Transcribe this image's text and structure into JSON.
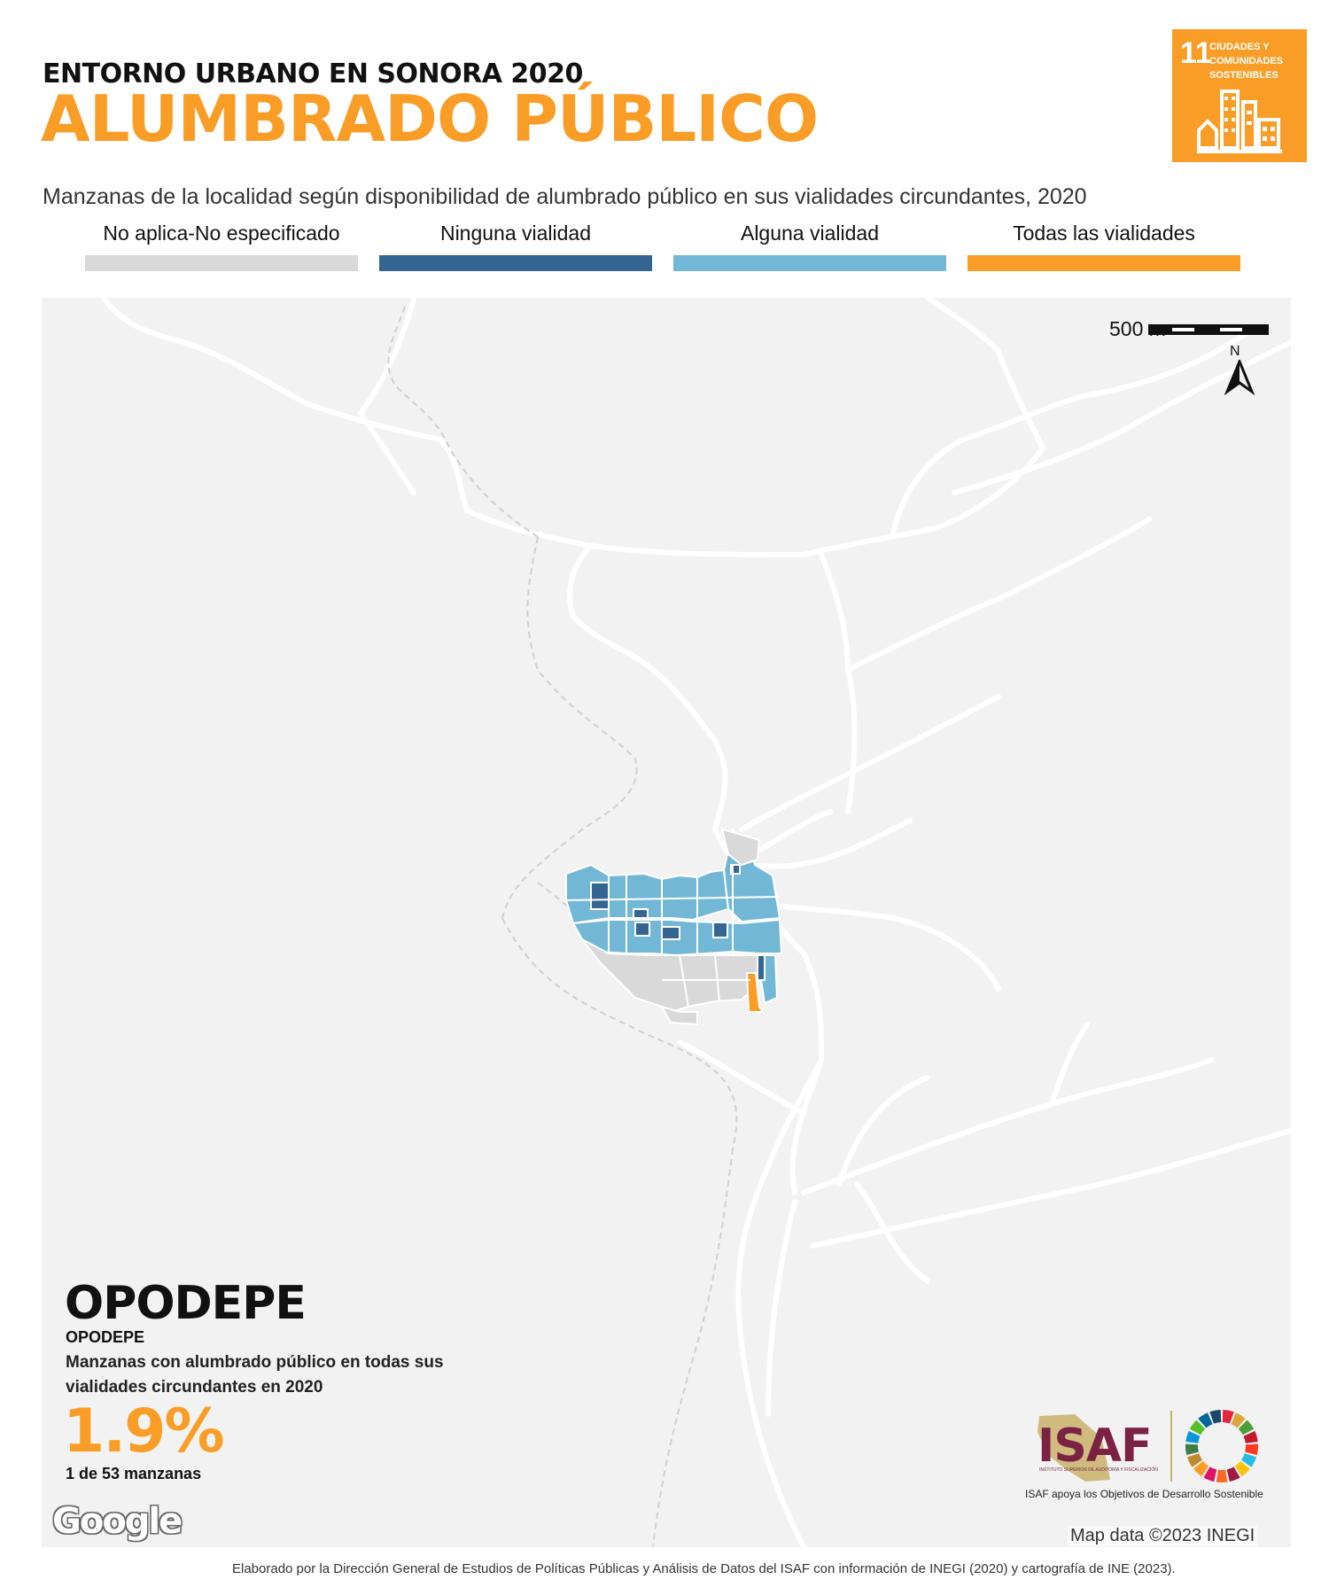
{
  "header": {
    "kicker": "ENTORNO URBANO EN SONORA 2020",
    "title": "ALUMBRADO PÚBLICO",
    "subtitle": "Manzanas de la localidad según disponibilidad de alumbrado público en sus vialidades circundantes, 2020"
  },
  "sdg_badge": {
    "number": "11",
    "text": "CIUDADES Y COMUNIDADES SOSTENIBLES",
    "color": "#f99d26",
    "icon": "city-buildings-icon"
  },
  "legend": [
    {
      "label": "No aplica-No especificado",
      "color": "#d9d9d9"
    },
    {
      "label": "Ninguna vialidad",
      "color": "#356592"
    },
    {
      "label": "Alguna vialidad",
      "color": "#72b8d6"
    },
    {
      "label": "Todas las vialidades",
      "color": "#f99d26"
    }
  ],
  "map": {
    "scale_label": "500 m",
    "north_label": "N",
    "attribution": "Map data ©2023 INEGI",
    "provider": "Google",
    "background_color": "#f2f2f2"
  },
  "municipality": {
    "name": "OPODEPE",
    "locality": "OPODEPE"
  },
  "stat": {
    "description": "Manzanas con alumbrado público en todas sus vialidades circundantes en 2020",
    "percent": "1.9%",
    "count": "1 de 53 manzanas"
  },
  "logos": {
    "isaf": "ISAF",
    "isaf_subtitle": "INSTITUTO SUPERIOR DE AUDITORÍA Y FISCALIZACIÓN",
    "isaf_tagline": "ISAF apoya los Objetivos de Desarrollo Sostenible",
    "isaf_color": "#7b2244"
  },
  "footer": "Elaborado por la Dirección General de Estudios de Políticas Públicas y Análisis de Datos del ISAF con información de INEGI (2020) y cartografía de INE (2023)."
}
